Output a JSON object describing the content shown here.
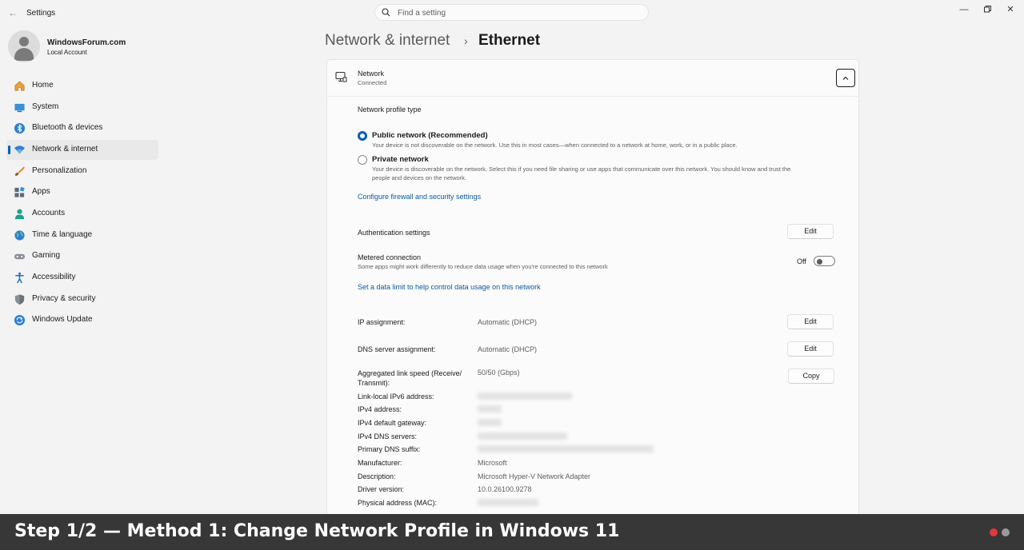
{
  "app": {
    "title": "Settings"
  },
  "search": {
    "placeholder": "Find a setting"
  },
  "account": {
    "name": "WindowsForum.com",
    "type": "Local Account"
  },
  "sidebar": {
    "items": [
      {
        "label": "Home",
        "icon": "home-icon"
      },
      {
        "label": "System",
        "icon": "system-icon"
      },
      {
        "label": "Bluetooth & devices",
        "icon": "bluetooth-icon"
      },
      {
        "label": "Network & internet",
        "icon": "network-icon",
        "active": true
      },
      {
        "label": "Personalization",
        "icon": "brush-icon"
      },
      {
        "label": "Apps",
        "icon": "apps-icon"
      },
      {
        "label": "Accounts",
        "icon": "accounts-icon"
      },
      {
        "label": "Time & language",
        "icon": "globe-clock-icon"
      },
      {
        "label": "Gaming",
        "icon": "gamepad-icon"
      },
      {
        "label": "Accessibility",
        "icon": "accessibility-icon"
      },
      {
        "label": "Privacy & security",
        "icon": "shield-icon"
      },
      {
        "label": "Windows Update",
        "icon": "update-icon"
      }
    ]
  },
  "breadcrumb": {
    "parent": "Network & internet",
    "separator": "›",
    "current": "Ethernet"
  },
  "network": {
    "name": "Network",
    "status": "Connected",
    "profile_heading": "Network profile type",
    "public_label": "Public network (Recommended)",
    "public_desc": "Your device is not discoverable on the network. Use this in most cases—when connected to a network at home, work, or in a public place.",
    "private_label": "Private network",
    "private_desc_line1": "Your device is discoverable on the network. Select this if you need file sharing or use apps that communicate over this network. You should know and trust the",
    "private_desc_line2": "people and devices on the network.",
    "selected_profile": "public",
    "firewall_link": "Configure firewall and security settings"
  },
  "auth": {
    "label": "Authentication settings",
    "button": "Edit"
  },
  "metered": {
    "label": "Metered connection",
    "desc": "Some apps might work differently to reduce data usage when you're connected to this network",
    "state": "Off",
    "data_limit_link": "Set a data limit to help control data usage on this network"
  },
  "ip": {
    "label": "IP assignment:",
    "value": "Automatic (DHCP)",
    "button": "Edit"
  },
  "dns": {
    "label": "DNS server assignment:",
    "value": "Automatic (DHCP)",
    "button": "Edit"
  },
  "properties": {
    "link_speed_label_1": "Aggregated link speed (Receive/",
    "link_speed_label_2": "Transmit):",
    "link_speed_value": "50/50 (Gbps)",
    "copy_button": "Copy",
    "rows": [
      {
        "label": "Link-local IPv6 address:",
        "value": "",
        "redacted": true
      },
      {
        "label": "IPv4 address:",
        "value": "",
        "redacted": true
      },
      {
        "label": "IPv4 default gateway:",
        "value": "",
        "redacted": true
      },
      {
        "label": "IPv4 DNS servers:",
        "value": "",
        "redacted": true
      },
      {
        "label": "Primary DNS suffix:",
        "value": "",
        "redacted": true
      },
      {
        "label": "Manufacturer:",
        "value": "Microsoft"
      },
      {
        "label": "Description:",
        "value": "Microsoft Hyper-V Network Adapter"
      },
      {
        "label": "Driver version:",
        "value": "10.0.26100.9278"
      },
      {
        "label": "Physical address (MAC):",
        "value": "",
        "redacted": true
      }
    ]
  },
  "overlay": {
    "caption": "Step 1/2 — Method 1: Change Network Profile in Windows 11",
    "dots": [
      {
        "color": "#e03a3a",
        "active": true
      },
      {
        "color": "#9a9a9a",
        "active": false
      }
    ]
  },
  "colors": {
    "accent": "#005fb8",
    "link": "#0c5aa6"
  }
}
